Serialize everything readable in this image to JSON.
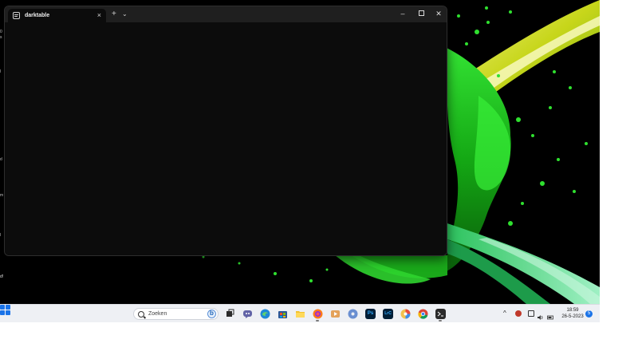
{
  "window": {
    "tab_title": "darktable",
    "tab_close_glyph": "×",
    "new_tab_glyph": "+",
    "dropdown_glyph": "⌄",
    "minimize_glyph": "–",
    "close_glyph": "✕"
  },
  "desktop": {
    "edge_glyphs": [
      "0",
      "s",
      "l",
      "d",
      "m",
      "l",
      "d!"
    ]
  },
  "taskbar": {
    "search_placeholder": "Zoeken",
    "apps": [
      {
        "name": "task-view",
        "label": ""
      },
      {
        "name": "chat",
        "label": ""
      },
      {
        "name": "edge",
        "label": ""
      },
      {
        "name": "store",
        "label": ""
      },
      {
        "name": "file-explorer",
        "label": ""
      },
      {
        "name": "firefox",
        "label": ""
      },
      {
        "name": "media-player",
        "label": ""
      },
      {
        "name": "disk-app",
        "label": ""
      },
      {
        "name": "photoshop",
        "label": "Ps"
      },
      {
        "name": "lightroom-classic",
        "label": "LrC"
      },
      {
        "name": "color-app",
        "label": ""
      },
      {
        "name": "chrome",
        "label": ""
      },
      {
        "name": "terminal",
        "label": ""
      }
    ],
    "tray": {
      "chevron_glyph": "^",
      "time": "18:59",
      "date": "26-5-2023",
      "notification_count": "5"
    }
  },
  "colors": {
    "accent": "#1a73e8",
    "terminal_bg": "#0c0c0c",
    "titlebar_bg": "#1f1f1f",
    "taskbar_bg": "#eef0f4",
    "wallpaper_green": "#1ec21e",
    "wallpaper_yellow": "#d6e21a"
  }
}
